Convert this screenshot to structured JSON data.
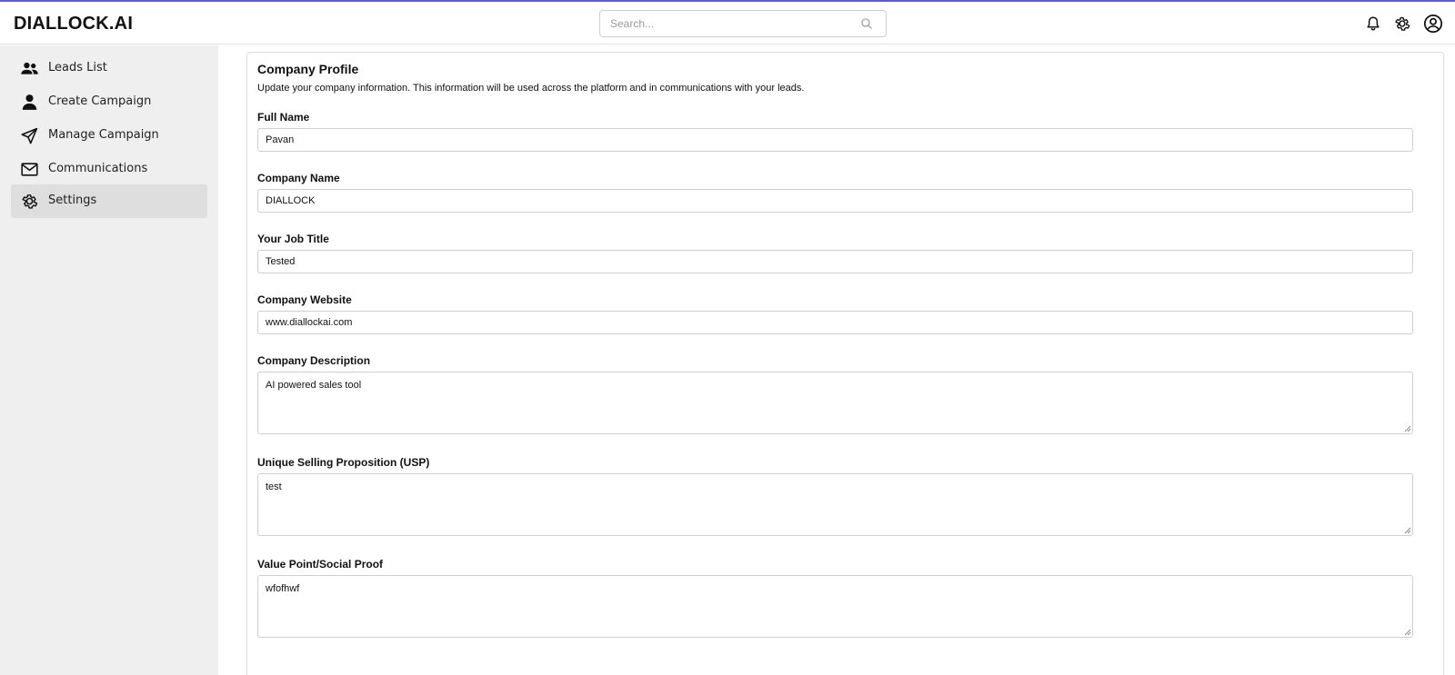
{
  "app": {
    "logo": "DIALLOCK.AI"
  },
  "header": {
    "search": {
      "placeholder": "Search...",
      "value": ""
    },
    "icons": [
      "bell-icon",
      "gear-icon",
      "user-circle-icon"
    ]
  },
  "sidebar": {
    "items": [
      {
        "label": "Leads List",
        "icon": "users-icon",
        "active": false
      },
      {
        "label": "Create Campaign",
        "icon": "user-icon",
        "active": false
      },
      {
        "label": "Manage Campaign",
        "icon": "send-icon",
        "active": false
      },
      {
        "label": "Communications",
        "icon": "mail-icon",
        "active": false
      },
      {
        "label": "Settings",
        "icon": "gear-icon",
        "active": true
      }
    ]
  },
  "profile": {
    "title": "Company Profile",
    "description": "Update your company information. This information will be used across the platform and in communications with your leads.",
    "fields": [
      {
        "label": "Full Name",
        "value": "Pavan"
      },
      {
        "label": "Company Name",
        "value": "DIALLOCK"
      },
      {
        "label": "Your Job Title",
        "value": "Tested"
      },
      {
        "label": "Company Website",
        "value": "www.diallockai.com"
      },
      {
        "label": "Company Description",
        "value": "AI powered sales tool"
      },
      {
        "label": "Unique Selling Proposition (USP)",
        "value": "test"
      },
      {
        "label": "Value Point/Social Proof",
        "value": "wfofhwf"
      }
    ]
  },
  "colors": {
    "accent_line": "#5b5fc7",
    "sidebar_bg": "#efefef",
    "active_item_bg": "#dedede"
  }
}
